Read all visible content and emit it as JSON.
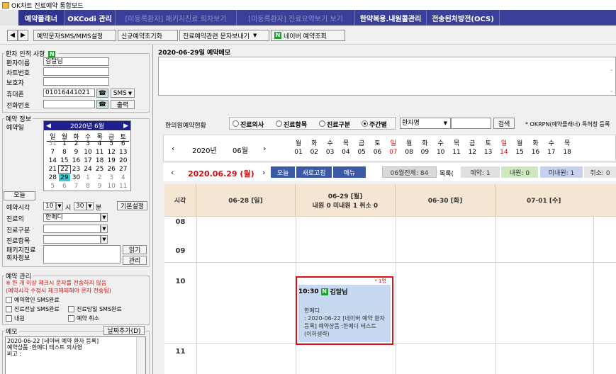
{
  "window": {
    "title": "OK차트 진료예약 통합보드"
  },
  "menu_tabs": [
    "예약플래너",
    "OKCodi 관리",
    "[미등록환자] 패키지진료 회차보기",
    "[미등록환자] 진료요약보기 보기",
    "한약복용.내원콜관리",
    "전송된처방전(OCS)"
  ],
  "toolbar": {
    "nav_left": "◀",
    "nav_right": "▶",
    "sms_settings": "예약문자SMS/MMS설정",
    "new_reset": "신규예약초기화",
    "send_view": "진료예약관련 문자보내기",
    "naver_view": "네이버 예약조회"
  },
  "patient": {
    "section_title": "환자 인적 사항",
    "name_label": "환자이름",
    "name_value": "김달님",
    "chart_label": "차트번호",
    "guardian_label": "보호자",
    "mobile_label": "휴대폰",
    "mobile_value": "01016441021",
    "sms_button": "SMS",
    "phone_label": "전화번호",
    "output_button": "출력"
  },
  "reservation": {
    "section_title": "예약 정보",
    "date_label": "예약일",
    "calendar_header": "2020년 6월",
    "weekdays": [
      "일",
      "월",
      "화",
      "수",
      "목",
      "금",
      "토"
    ],
    "weeks": [
      [
        "31",
        "1",
        "2",
        "3",
        "4",
        "5",
        "6"
      ],
      [
        "7",
        "8",
        "9",
        "10",
        "11",
        "12",
        "13"
      ],
      [
        "14",
        "15",
        "16",
        "17",
        "18",
        "19",
        "20"
      ],
      [
        "21",
        "22",
        "23",
        "24",
        "25",
        "26",
        "27"
      ],
      [
        "28",
        "29",
        "30",
        "1",
        "2",
        "3",
        "4"
      ],
      [
        "5",
        "6",
        "7",
        "8",
        "9",
        "10",
        "11"
      ]
    ],
    "selected_day": "29",
    "today_button": "오늘",
    "time_label": "예약시각",
    "hour_value": "10",
    "hour_unit": "시",
    "minute_value": "30",
    "minute_unit": "분",
    "default_settings": "기본설정",
    "doctor_label": "진료의",
    "doctor_value": "한메디",
    "category_label": "진료구분",
    "item_label": "진료항목",
    "package_label1": "패키지진료",
    "package_label2": "회차정보",
    "read_button": "읽기",
    "manage_button": "관리"
  },
  "management": {
    "section_title": "예약 관리",
    "warning1": "※ 한 개 이상 체크시 문자를 전송하지 않음",
    "warning2": "(예약시각 수정시 체크해제해야 문자 전송됨)",
    "chk_confirm": "예약확인 SMS완료",
    "chk_prevday": "진료전날 SMS완료",
    "chk_sameday": "진료당일 SMS완료",
    "chk_visit": "내원",
    "chk_cancel": "예약 취소"
  },
  "memo_left": {
    "title": "메모",
    "add_button": "날짜추가(D)",
    "lines": [
      "2020-06-22 [네이버 예약 환자 등록]",
      "예약상품 :한메디 테스트 의사형",
      "비고 :"
    ]
  },
  "day_memo": {
    "title": "2020-06-29일 예약메모"
  },
  "filter": {
    "label": "한의원예약현황",
    "options": [
      "진료의사",
      "진료항목",
      "진료구분",
      "주간별"
    ],
    "selected": "주간별",
    "patient_select": "환자명",
    "search_button": "검색",
    "notice": "* OKRPN(예약플래너) 특허청 등록"
  },
  "date_strip": {
    "year": "2020년",
    "month": "06월",
    "days": [
      {
        "w": "월",
        "d": "01"
      },
      {
        "w": "화",
        "d": "02"
      },
      {
        "w": "수",
        "d": "03"
      },
      {
        "w": "목",
        "d": "04"
      },
      {
        "w": "금",
        "d": "05"
      },
      {
        "w": "토",
        "d": "06"
      },
      {
        "w": "일",
        "d": "07"
      },
      {
        "w": "월",
        "d": "08"
      },
      {
        "w": "화",
        "d": "09"
      },
      {
        "w": "수",
        "d": "10"
      },
      {
        "w": "목",
        "d": "11"
      },
      {
        "w": "금",
        "d": "12"
      },
      {
        "w": "토",
        "d": "13"
      },
      {
        "w": "일",
        "d": "14"
      },
      {
        "w": "월",
        "d": "15"
      },
      {
        "w": "화",
        "d": "16"
      },
      {
        "w": "수",
        "d": "17"
      },
      {
        "w": "목",
        "d": "18"
      }
    ]
  },
  "nav": {
    "current_date": "2020.06.29 (월)",
    "today": "오늘",
    "refresh": "새로고침",
    "menu": "메뉴",
    "june_total": "06월전체: 84",
    "list_label": "목록(",
    "reserved": "예약: 1",
    "visited": "내원: 0",
    "not_visited": "미내원: 1",
    "cancelled": "취소: 0"
  },
  "grid": {
    "time_header": "시각",
    "columns": [
      "06-28 [일]",
      "06-29 [월]",
      "06-30 [화]",
      "07-01 [수]"
    ],
    "today_summary": "내원 0 미내원 1 취소 0",
    "hours": [
      "08",
      "09",
      "10",
      "11"
    ]
  },
  "appointment": {
    "count": "* 1명",
    "time": "10:30",
    "patient": "김달님",
    "doctor": "한메디",
    "detail1": ": 2020-06-22 [네이버 예약 환자",
    "detail2": "등록] 예약상품 :한메디 테스트",
    "detail3": "(이하생략)"
  },
  "colors": {
    "menu_bg": "#3b3f9a",
    "naver_green": "#17a02a",
    "header_bg": "#f5e6d3",
    "appt_bg": "#c7d9f1",
    "highlight_red": "#e01010"
  }
}
